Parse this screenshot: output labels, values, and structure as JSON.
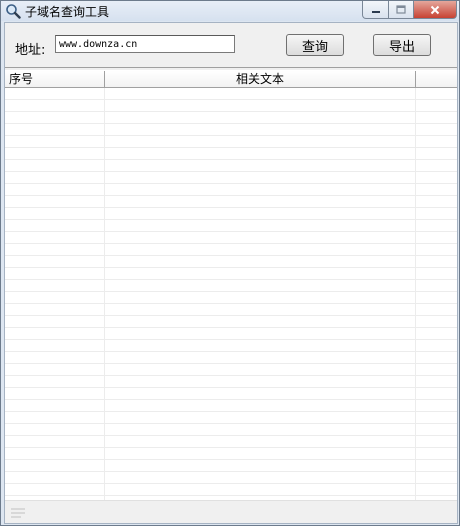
{
  "window": {
    "title": "子域名查询工具",
    "icon": "magnifier-icon",
    "buttons": {
      "minimize": "minimize-icon",
      "maximize": "maximize-icon",
      "close": "close-icon"
    }
  },
  "toolbar": {
    "address_label": "地址:",
    "address_value": "www.downza.cn",
    "query_label": "查询",
    "export_label": "导出"
  },
  "table": {
    "columns": [
      "序号",
      "相关文本",
      ""
    ],
    "rows": []
  }
}
